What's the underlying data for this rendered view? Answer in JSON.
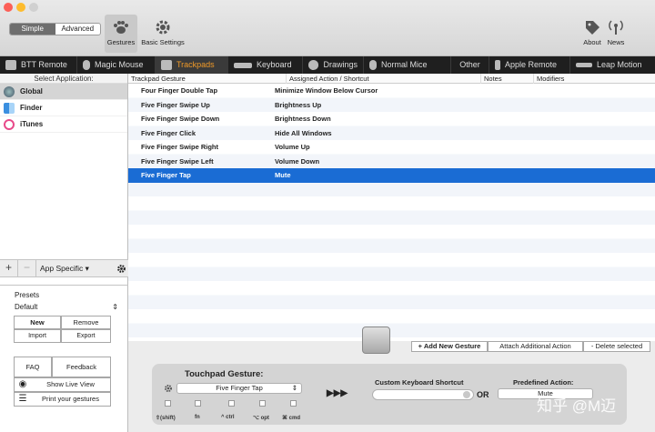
{
  "toolbar": {
    "mode_simple": "Simple",
    "mode_advanced": "Advanced",
    "gestures_label": "Gestures",
    "basic_settings_label": "Basic Settings",
    "about_label": "About",
    "news_label": "News"
  },
  "tabs": [
    {
      "label": "BTT Remote"
    },
    {
      "label": "Magic Mouse"
    },
    {
      "label": "Trackpads"
    },
    {
      "label": "Keyboard"
    },
    {
      "label": "Drawings"
    },
    {
      "label": "Normal Mice"
    },
    {
      "label": "Other"
    },
    {
      "label": "Apple Remote"
    },
    {
      "label": "Leap Motion"
    }
  ],
  "apps": {
    "header": "Select Application:",
    "items": [
      {
        "name": "Global"
      },
      {
        "name": "Finder"
      },
      {
        "name": "iTunes"
      }
    ],
    "scope_popup": "App Specific"
  },
  "presets": {
    "label": "Presets",
    "selected": "Default",
    "new_label": "New",
    "remove_label": "Remove",
    "import_label": "Import",
    "export_label": "Export",
    "faq_label": "FAQ",
    "feedback_label": "Feedback",
    "live_view_label": "Show Live View",
    "print_label": "Print your gestures"
  },
  "table": {
    "columns": [
      "Trackpad Gesture",
      "Assigned Action / Shortcut",
      "Notes",
      "Modifiers"
    ],
    "rows": [
      {
        "gesture": "Four Finger Double Tap",
        "action": "Minimize Window Below Cursor"
      },
      {
        "gesture": "Five Finger Swipe Up",
        "action": "Brightness Up"
      },
      {
        "gesture": "Five Finger Swipe Down",
        "action": "Brightness Down"
      },
      {
        "gesture": "Five Finger Click",
        "action": "Hide All Windows"
      },
      {
        "gesture": "Five Finger Swipe Right",
        "action": "Volume Up"
      },
      {
        "gesture": "Five Finger Swipe Left",
        "action": "Volume Down"
      },
      {
        "gesture": "Five Finger Tap",
        "action": "Mute"
      }
    ],
    "selected_index": 6
  },
  "actions": {
    "add_label": "+ Add New Gesture",
    "attach_label": "Attach Additional Action",
    "delete_label": "- Delete selected"
  },
  "editor": {
    "touchpad_label": "Touchpad Gesture:",
    "gesture_value": "Five Finger Tap",
    "arrows": "▶▶▶",
    "shortcut_label": "Custom Keyboard Shortcut",
    "or_label": "OR",
    "predefined_label": "Predefined Action:",
    "predefined_value": "Mute",
    "modifiers": [
      "⇧(shift)",
      "fn",
      "^ ctrl",
      "⌥ opt",
      "⌘ cmd"
    ]
  },
  "watermark": "知乎 @M迈"
}
